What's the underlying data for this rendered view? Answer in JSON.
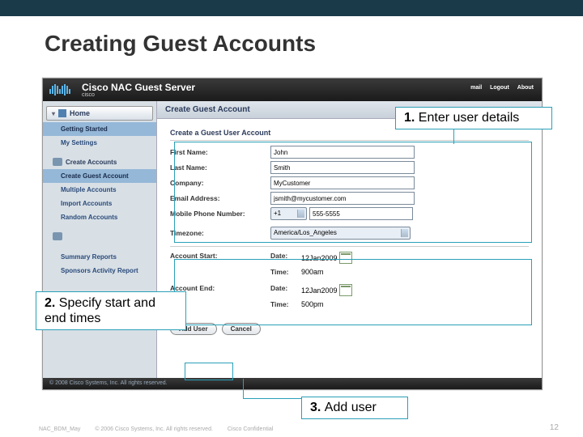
{
  "slide": {
    "title": "Creating Guest Accounts",
    "callouts": {
      "c1": {
        "num": "1.",
        "text": "Enter user details"
      },
      "c2": {
        "num": "2.",
        "text": "Specify start and end times"
      },
      "c3": {
        "num": "3.",
        "text": "Add user"
      }
    },
    "footer": {
      "code": "NAC_BDM_May",
      "copyright": "© 2006 Cisco Systems, Inc. All rights reserved.",
      "conf": "Cisco Confidential",
      "page": "12"
    }
  },
  "app": {
    "brand_small": "cisco",
    "brand": "Cisco NAC Guest Server",
    "header_links": {
      "mail": "mail",
      "logout": "Logout",
      "about": "About"
    },
    "sidebar": {
      "home": "Home",
      "items": [
        {
          "label": "Getting Started",
          "cls": "sel"
        },
        {
          "label": "My Settings"
        },
        {
          "sep": true
        },
        {
          "label": "Create Accounts",
          "grp": true
        },
        {
          "label": "Create Guest Account",
          "cls": "sel"
        },
        {
          "label": "Multiple Accounts"
        },
        {
          "label": "Import Accounts"
        },
        {
          "label": "Random Accounts"
        },
        {
          "sep": true
        },
        {
          "label": "",
          "grp": true
        },
        {
          "label": ""
        },
        {
          "label": "Summary Reports"
        },
        {
          "label": "Sponsors Activity Report"
        },
        {
          "label": ""
        }
      ]
    },
    "main": {
      "header": "Create Guest Account",
      "section": "Create a Guest User Account",
      "fields": {
        "first_name": {
          "label": "First Name:",
          "value": "John"
        },
        "last_name": {
          "label": "Last Name:",
          "value": "Smith"
        },
        "company": {
          "label": "Company:",
          "value": "MyCustomer"
        },
        "email": {
          "label": "Email Address:",
          "value": "jsmith@mycustomer.com"
        },
        "mobile": {
          "label": "Mobile Phone Number:",
          "cc": "+1",
          "value": "555-5555"
        },
        "timezone": {
          "label": "Timezone:",
          "value": "America/Los_Angeles"
        },
        "start": {
          "label": "Account Start:",
          "date_label": "Date:",
          "d": "12",
          "m": "Jan",
          "y": "2009",
          "time_label": "Time:",
          "h": "9",
          "min": "00",
          "ap": "am"
        },
        "end": {
          "label": "Account End:",
          "date_label": "Date:",
          "d": "12",
          "m": "Jan",
          "y": "2009",
          "time_label": "Time:",
          "h": "5",
          "min": "00",
          "ap": "pm"
        }
      },
      "buttons": {
        "add": "Add User",
        "cancel": "Cancel"
      },
      "footer": "© 2008 Cisco Systems, Inc. All rights reserved."
    }
  }
}
